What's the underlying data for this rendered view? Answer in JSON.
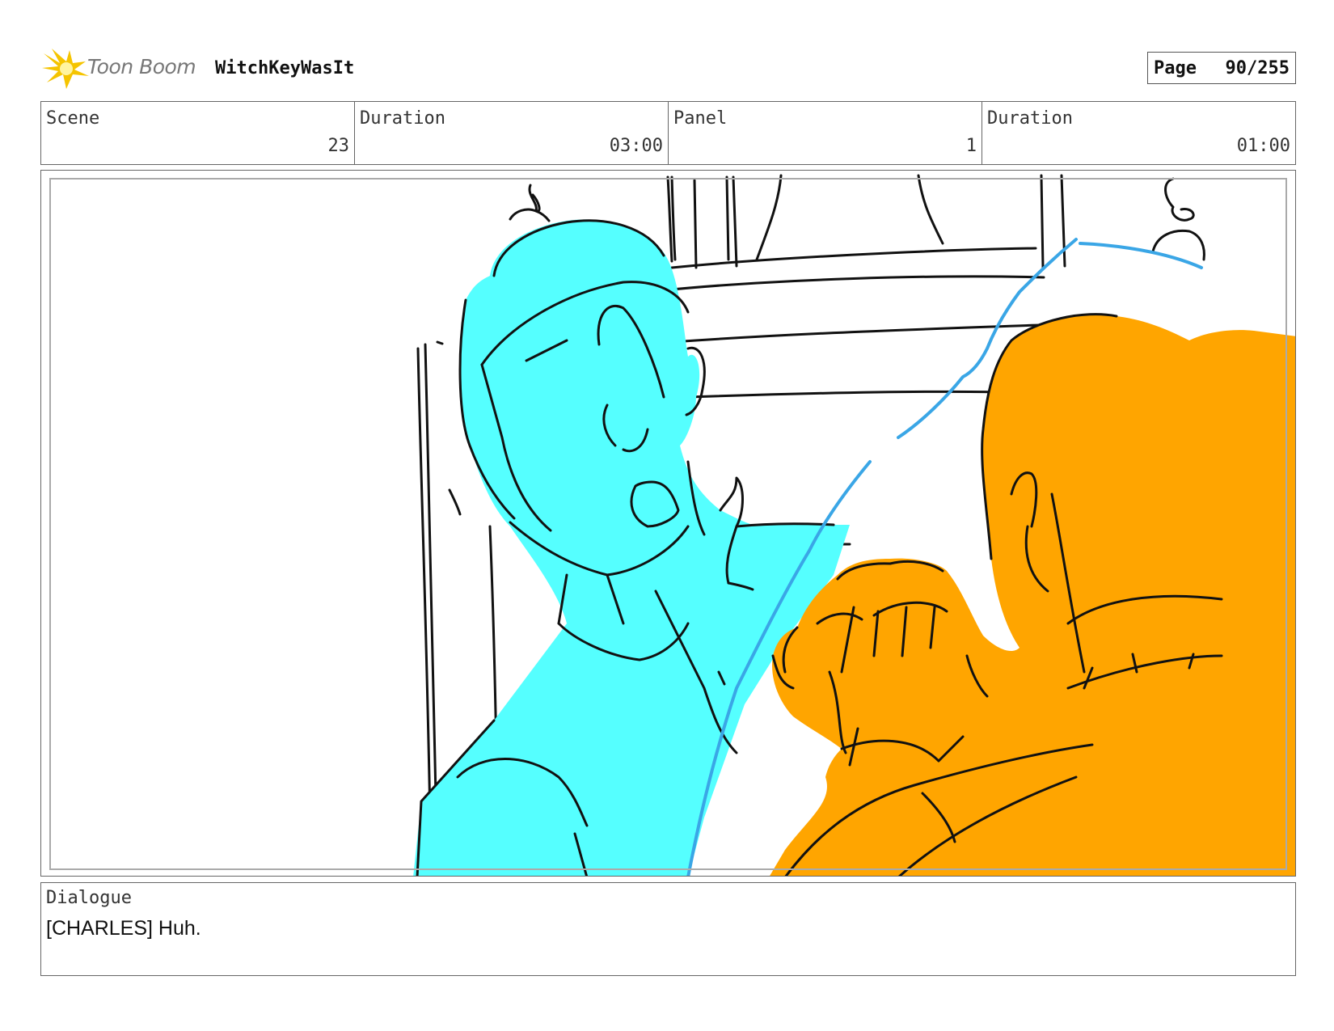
{
  "header": {
    "logo_text": "Toon Boom",
    "project_title": "WitchKeyWasIt",
    "page_label": "Page",
    "page_number": "90/255"
  },
  "info": {
    "scene_label": "Scene",
    "scene_value": "23",
    "scene_duration_label": "Duration",
    "scene_duration_value": "03:00",
    "panel_label": "Panel",
    "panel_value": "1",
    "panel_duration_label": "Duration",
    "panel_duration_value": "01:00"
  },
  "dialogue": {
    "label": "Dialogue",
    "text": "[CHARLES] Huh."
  },
  "colors": {
    "cyan_character": "#55ffff",
    "orange_character": "#ffa500",
    "blue_line": "#3aa6e6",
    "logo_yellow": "#f5c400",
    "ink": "#111111"
  },
  "icons": {
    "logo": "toon-boom-burst-icon"
  }
}
